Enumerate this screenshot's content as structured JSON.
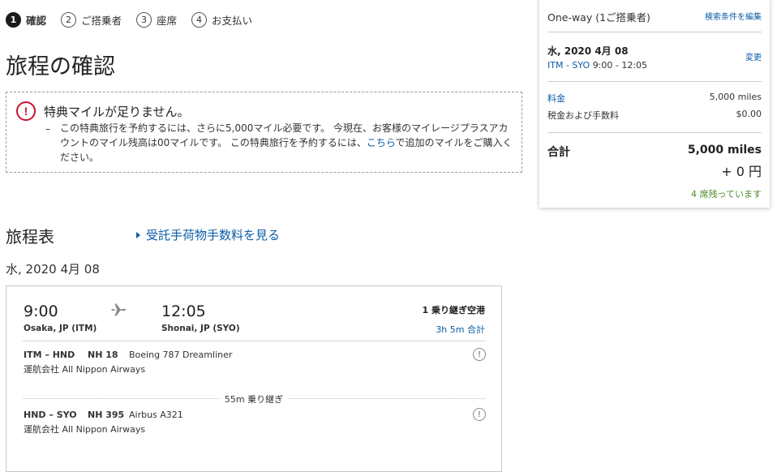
{
  "steps": [
    {
      "num": "1",
      "label": "確認"
    },
    {
      "num": "2",
      "label": "ご搭乗者"
    },
    {
      "num": "3",
      "label": "座席"
    },
    {
      "num": "4",
      "label": "お支払い"
    }
  ],
  "page_title": "旅程の確認",
  "alert": {
    "title": "特典マイルが足りません。",
    "dash": "–",
    "body_part1": "この特典旅行を予約するには、さらに5,000マイル必要です。 今現在、お客様のマイレージプラスアカウントのマイル残高は00マイルです。 この特典旅行を予約するには、",
    "link": "こちら",
    "body_part2": "で追加のマイルをご購入ください。",
    "icon": "alert-circle-icon",
    "color": "#c8102e"
  },
  "itinerary": {
    "title": "旅程表",
    "baggage_link": "受託手荷物手数料を見る",
    "date": "水, 2020 4月 08",
    "flight": {
      "depart_time": "9:00",
      "depart_city": "Osaka, JP (ITM)",
      "arrive_time": "12:05",
      "arrive_city": "Shonai, JP (SYO)",
      "connections": "1 乗り継ぎ空港",
      "duration": "3h 5m 合計",
      "segments": [
        {
          "route": "ITM – HND",
          "flight": "NH 18",
          "aircraft": "Boeing 787 Dreamliner",
          "operator": "運航会社 All Nippon Airways"
        },
        {
          "route": "HND – SYO",
          "flight": "NH 395",
          "aircraft": "Airbus A321",
          "operator": "運航会社 All Nippon Airways"
        }
      ],
      "layover": "55m 乗り継ぎ"
    }
  },
  "summary": {
    "trip_type": "One-way (1ご搭乗者)",
    "edit_link": "検索条件を編集",
    "date": "水, 2020 4月 08",
    "change_link": "変更",
    "route_codes": "ITM - SYO",
    "route_times": "9:00 - 12:05",
    "fare_label": "料金",
    "fare_value": "5,000 miles",
    "tax_label": "税金および手数料",
    "tax_value": "$0.00",
    "total_label": "合計",
    "total_miles": "5,000 miles",
    "total_yen": "+ 0 円",
    "seats_left": "4 席残っています"
  },
  "colors": {
    "link": "#0b5ca8",
    "seats": "#4e8a2b"
  }
}
